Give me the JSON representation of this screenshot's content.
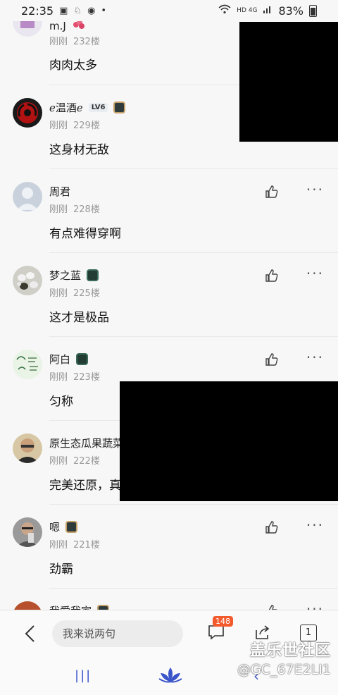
{
  "status_bar": {
    "time": "22:35",
    "network": "HD 4G",
    "battery": "83%",
    "icons": [
      "image-icon",
      "notification-icon",
      "eye-icon",
      "dot-icon",
      "wifi-icon",
      "signal-icon",
      "battery-icon"
    ]
  },
  "comments": [
    {
      "name": "m.J",
      "time": "刚刚",
      "floor": "232楼",
      "content": "肉肉太多",
      "badges": [
        "flower-icon"
      ]
    },
    {
      "name": "ℯ温酒ℯ",
      "time": "刚刚",
      "floor": "229楼",
      "content": "这身材无敌",
      "badges": [
        "LV6",
        "medal-icon"
      ],
      "level": "LV6"
    },
    {
      "name": "周君",
      "time": "刚刚",
      "floor": "228楼",
      "content": "有点难得穿啊",
      "badges": []
    },
    {
      "name": "梦之蓝",
      "time": "刚刚",
      "floor": "225楼",
      "content": "这才是极品",
      "badges": [
        "medal-icon"
      ]
    },
    {
      "name": "阿白",
      "time": "刚刚",
      "floor": "223楼",
      "content": "匀称",
      "badges": [
        "medal-icon"
      ]
    },
    {
      "name": "原生态瓜果蔬菜",
      "time": "刚刚",
      "floor": "222楼",
      "content": "完美还原，真",
      "badges": []
    },
    {
      "name": "嗯",
      "time": "刚刚",
      "floor": "221楼",
      "content": "劲霸",
      "badges": [
        "medal-icon"
      ]
    },
    {
      "name": "我爱我家",
      "time": "",
      "floor": "",
      "content": "",
      "badges": [
        "medal-icon"
      ]
    }
  ],
  "bottom_bar": {
    "input_placeholder": "我来说两句",
    "comment_count": "148",
    "page": "1"
  },
  "watermark": {
    "title": "盖乐世社区",
    "user": "@GC_67E2LI1"
  },
  "colors": {
    "badge_orange": "#f35b2c",
    "nav_blue": "#3a55c9",
    "meta_gray": "#999999"
  }
}
